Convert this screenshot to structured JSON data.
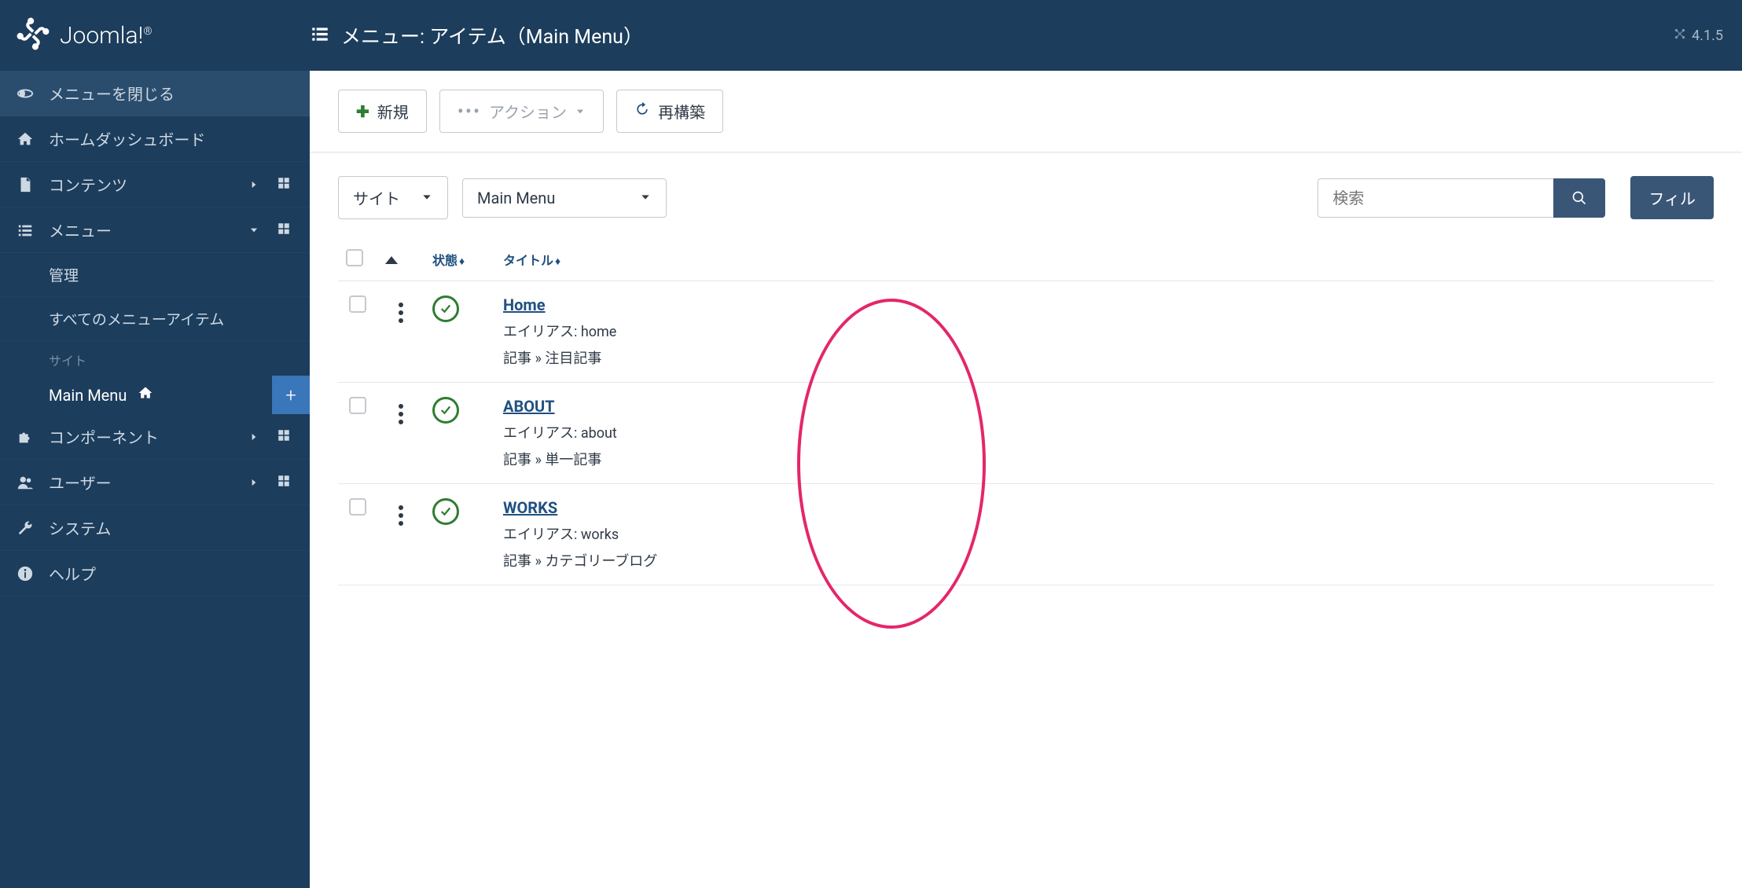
{
  "brand": "Joomla!",
  "version": "4.1.5",
  "page_title": "メニュー: アイテム（Main Menu）",
  "sidebar": {
    "collapse": "メニューを閉じる",
    "home": "ホームダッシュボード",
    "content": "コンテンツ",
    "menus": "メニュー",
    "manage": "管理",
    "all_items": "すべてのメニューアイテム",
    "site_label": "サイト",
    "main_menu": "Main Menu",
    "components": "コンポーネント",
    "users": "ユーザー",
    "system": "システム",
    "help": "ヘルプ"
  },
  "toolbar": {
    "new": "新規",
    "actions": "アクション",
    "rebuild": "再構築"
  },
  "filters": {
    "client": "サイト",
    "menu": "Main Menu",
    "search_placeholder": "検索",
    "filter_btn": "フィル"
  },
  "columns": {
    "status": "状態",
    "title": "タイトル"
  },
  "labels": {
    "alias_prefix": "エイリアス: ",
    "article_prefix": "記事 » "
  },
  "rows": [
    {
      "title": "Home",
      "alias": "home",
      "type": "注目記事"
    },
    {
      "title": "ABOUT",
      "alias": "about",
      "type": "単一記事"
    },
    {
      "title": "WORKS",
      "alias": "works",
      "type": "カテゴリーブログ"
    }
  ]
}
